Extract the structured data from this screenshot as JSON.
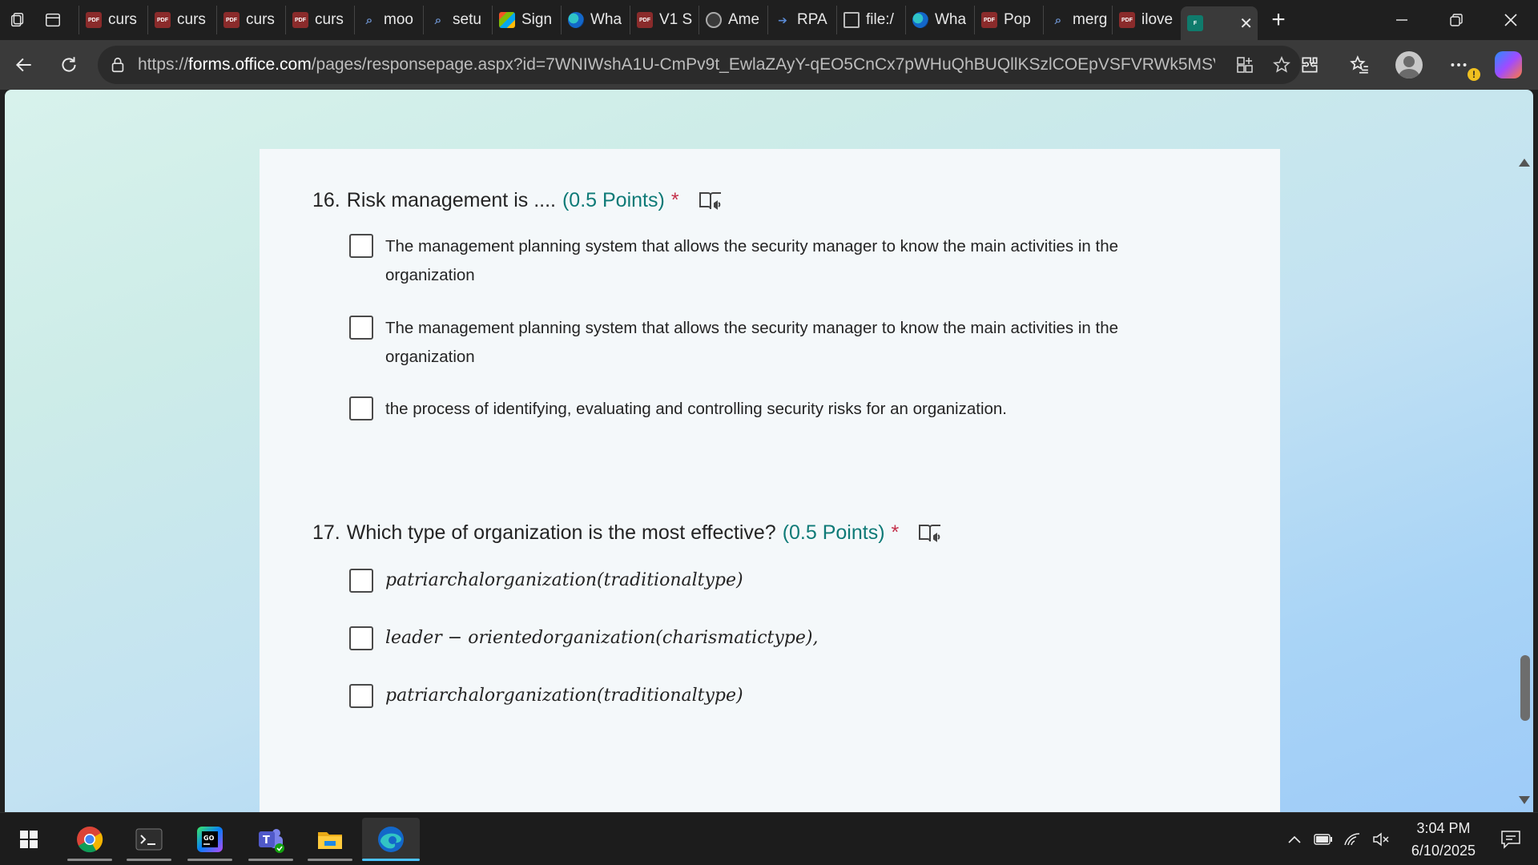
{
  "browser": {
    "tabs": [
      {
        "label": "curs",
        "icon": "pdf-icon"
      },
      {
        "label": "curs",
        "icon": "pdf-icon"
      },
      {
        "label": "curs",
        "icon": "pdf-icon"
      },
      {
        "label": "curs",
        "icon": "pdf-icon"
      },
      {
        "label": "moo",
        "icon": "search-icon"
      },
      {
        "label": "setu",
        "icon": "search-icon"
      },
      {
        "label": "Sign",
        "icon": "microsoft-icon"
      },
      {
        "label": "Wha",
        "icon": "edge-icon"
      },
      {
        "label": "V1 S",
        "icon": "pdf-icon"
      },
      {
        "label": "Ame",
        "icon": "chatgpt-icon"
      },
      {
        "label": "RPA",
        "icon": "rpa-icon"
      },
      {
        "label": "file:/",
        "icon": "file-icon"
      },
      {
        "label": "Wha",
        "icon": "edge-icon"
      },
      {
        "label": "Pop",
        "icon": "pdf-icon"
      },
      {
        "label": "merg",
        "icon": "search-icon"
      },
      {
        "label": "ilove",
        "icon": "pdf-icon"
      }
    ],
    "active_tab": {
      "label": "",
      "icon": "forms-icon",
      "close": "✕"
    },
    "new_tab": "+",
    "url_prefix": "https://",
    "url_host": "forms.office.com",
    "url_rest": "/pages/responsepage.aspx?id=7WNIWshA1U-CmPv9t_EwlaZAyY-qEO5CnCx7pWHuQhBUQllKSzlCOEpVSFVRWk5MSVV..."
  },
  "form": {
    "questions": [
      {
        "number": "16.",
        "title": "Risk management is ....",
        "points": "(0.5 Points)",
        "required": "*",
        "options": [
          "The management planning system that allows the security manager to know the main activities in the organization",
          "The management planning system that allows the security manager to know the main activities in the organization",
          "the process of identifying, evaluating and controlling security risks for an organization."
        ]
      },
      {
        "number": "17.",
        "title": "Which type of organization is the most effective?",
        "points": "(0.5 Points)",
        "required": "*",
        "options": [
          "patriarchalorganization(traditionaltype)",
          "leader − orientedorganization(charismatictype),",
          "patriarchalorganization(traditionaltype)"
        ]
      }
    ]
  },
  "taskbar": {
    "time": "3:04 PM",
    "date": "6/10/2025",
    "accent": "#4cc2ff"
  }
}
